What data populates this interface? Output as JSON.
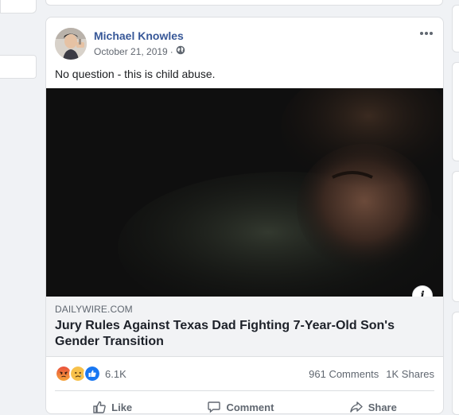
{
  "post": {
    "author": "Michael Knowles",
    "date": "October 21, 2019",
    "separator": "·",
    "audience_icon": "globe-icon",
    "text": "No question - this is child abuse.",
    "link": {
      "domain": "DAILYWIRE.COM",
      "title": "Jury Rules Against Texas Dad Fighting 7-Year-Old Son's Gender Transition"
    },
    "stats": {
      "reaction_icons": [
        "angry-icon",
        "sad-icon",
        "like-icon"
      ],
      "reaction_count": "6.1K",
      "comments": "961 Comments",
      "shares": "1K Shares"
    },
    "actions": [
      {
        "label": "Like",
        "icon": "thumbs-up-icon"
      },
      {
        "label": "Comment",
        "icon": "comment-icon"
      },
      {
        "label": "Share",
        "icon": "share-icon"
      }
    ]
  },
  "colors": {
    "author_link": "#385898",
    "background": "#f0f2f5",
    "like_blue": "#1877f2",
    "angry_orange": "#f0653a",
    "sad_yellow": "#f7c14b"
  }
}
